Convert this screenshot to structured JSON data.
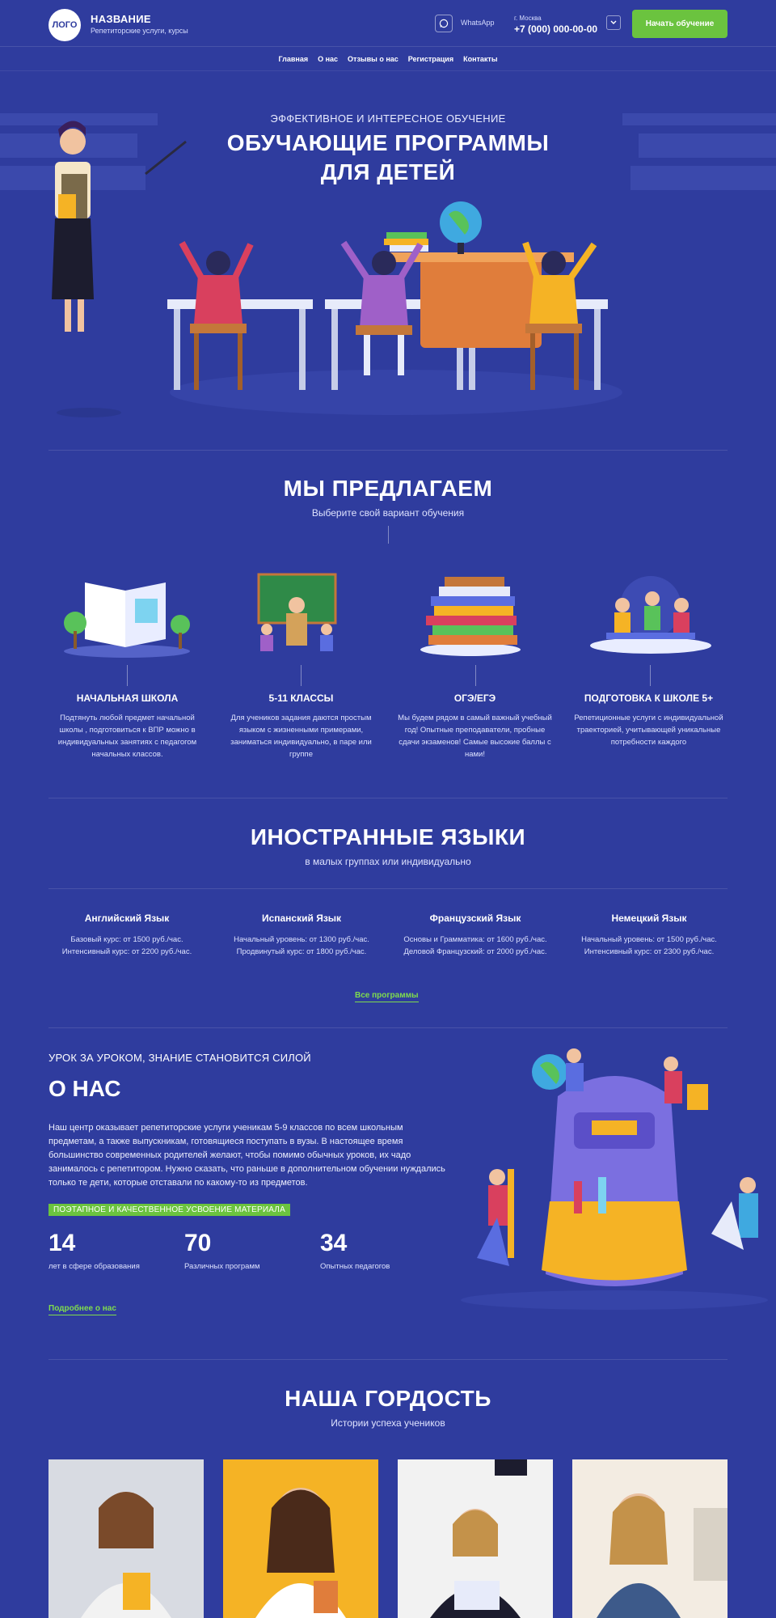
{
  "header": {
    "logo": "ЛОГО",
    "brand_name": "НАЗВАНИЕ",
    "brand_sub": "Репетиторские услуги, курсы",
    "whatsapp": "WhatsApp",
    "city": "г. Москва",
    "phone": "+7 (000) 000-00-00",
    "cta": "Начать обучение"
  },
  "nav": [
    "Главная",
    "О нас",
    "Отзывы о нас",
    "Регистрация",
    "Контакты"
  ],
  "hero": {
    "eyebrow": "ЭФФЕКТИВНОЕ И ИНТЕРЕСНОЕ ОБУЧЕНИЕ",
    "title_line1": "ОБУЧАЮЩИЕ ПРОГРАММЫ",
    "title_line2": "ДЛЯ ДЕТЕЙ"
  },
  "offer": {
    "title": "МЫ ПРЕДЛАГАЕМ",
    "subtitle": "Выберите свой вариант обучения",
    "cards": [
      {
        "title": "НАЧАЛЬНАЯ ШКОЛА",
        "text": "Подтянуть любой предмет начальной школы , подготовиться к ВПР можно в индивидуальных занятиях с педагогом начальных классов."
      },
      {
        "title": "5-11 КЛАССЫ",
        "text": "Для учеников задания даются простым языком с жизненными примерами, заниматься индивидуально, в паре или группе"
      },
      {
        "title": "ОГЭ/ЕГЭ",
        "text": "Мы будем рядом в самый важный учебный год! Опытные преподаватели, пробные сдачи экзаменов! Самые высокие баллы с нами!"
      },
      {
        "title": "ПОДГОТОВКА К ШКОЛЕ 5+",
        "text": "Репетиционные услуги с индивидуальной траекторией, учитывающей уникальные потребности каждого"
      }
    ]
  },
  "languages": {
    "title": "ИНОСТРАННЫЕ ЯЗЫКИ",
    "subtitle": "в малых группах или индивидуально",
    "items": [
      {
        "title": "Английский Язык",
        "line1": "Базовый курс: от 1500 руб./час.",
        "line2": "Интенсивный курс: от 2200 руб./час."
      },
      {
        "title": "Испанский Язык",
        "line1": "Начальный уровень: от 1300 руб./час.",
        "line2": "Продвинутый курс: от 1800 руб./час."
      },
      {
        "title": "Французский Язык",
        "line1": "Основы и Грамматика: от 1600 руб./час.",
        "line2": "Деловой Французский: от 2000 руб./час."
      },
      {
        "title": "Немецкий Язык",
        "line1": "Начальный уровень: от 1500 руб./час.",
        "line2": "Интенсивный курс: от 2300 руб./час."
      }
    ],
    "link": "Все программы"
  },
  "about": {
    "eyebrow": "УРОК ЗА УРОКОМ, ЗНАНИЕ СТАНОВИТСЯ СИЛОЙ",
    "title": "О НАС",
    "text": "Наш центр оказывает репетиторские услуги ученикам 5-9 классов по всем школьным предметам, а также выпускникам, готовящиеся поступать в вузы. В настоящее время большинство современных родителей желают, чтобы помимо обычных уроков, их чадо занималось с репетитором. Нужно сказать, что раньше в дополнительном обучении нуждались только те дети, которые отставали по какому-то из предметов.",
    "badge": "ПОЭТАПНОЕ И КАЧЕСТВЕННОЕ УСВОЕНИЕ МАТЕРИАЛА",
    "stats": [
      {
        "num": "14",
        "label": "лет в сфере образования"
      },
      {
        "num": "70",
        "label": "Различных программ"
      },
      {
        "num": "34",
        "label": "Опытных педагогов"
      }
    ],
    "link": "Подробнее о нас"
  },
  "pride": {
    "title": "НАША ГОРДОСТЬ",
    "subtitle": "Истории успеха учеников"
  },
  "colors": {
    "background": "#2f3c9e",
    "accent": "#6bc33f"
  }
}
